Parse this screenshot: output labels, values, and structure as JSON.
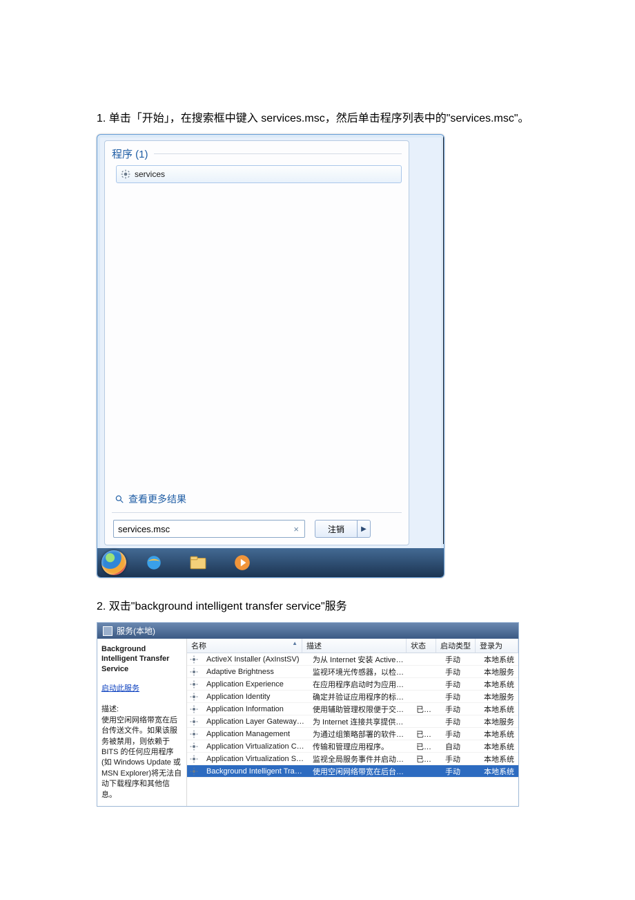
{
  "step1": "1. 单击「开始」，在搜索框中键入 services.msc，然后单击程序列表中的\"services.msc\"。",
  "step2": "2. 双击\"background intelligent transfer service\"服务",
  "startmenu": {
    "group_header": "程序 (1)",
    "result_label": "services",
    "more_results": "查看更多结果",
    "search_value": "services.msc",
    "logoff_label": "注销"
  },
  "services": {
    "window_title": "服务(本地)",
    "left": {
      "title": "Background Intelligent Transfer Service",
      "action": "启动此服务",
      "desc_header": "描述:",
      "desc": "使用空闲网络带宽在后台传送文件。如果该服务被禁用，则依赖于 BITS 的任何应用程序(如 Windows Update 或 MSN Explorer)将无法自动下载程序和其他信息。"
    },
    "columns": {
      "name": "名称",
      "desc": "描述",
      "status": "状态",
      "start": "启动类型",
      "logon": "登录为"
    },
    "rows": [
      {
        "name": "ActiveX Installer (AxInstSV)",
        "desc": "为从 Internet 安装 ActiveX 控件...",
        "status": "",
        "start": "手动",
        "logon": "本地系统"
      },
      {
        "name": "Adaptive Brightness",
        "desc": "监视环境光传感器，以检测环境光...",
        "status": "",
        "start": "手动",
        "logon": "本地服务"
      },
      {
        "name": "Application Experience",
        "desc": "在应用程序启动时为应用程序处理...",
        "status": "",
        "start": "手动",
        "logon": "本地系统"
      },
      {
        "name": "Application Identity",
        "desc": "确定并验证应用程序的标识。禁用...",
        "status": "",
        "start": "手动",
        "logon": "本地服务"
      },
      {
        "name": "Application Information",
        "desc": "使用辅助管理权限便于交互式应用...",
        "status": "已启动",
        "start": "手动",
        "logon": "本地系统"
      },
      {
        "name": "Application Layer Gateway Service",
        "desc": "为 Internet 连接共享提供第三方...",
        "status": "",
        "start": "手动",
        "logon": "本地服务"
      },
      {
        "name": "Application Management",
        "desc": "为通过组策略部署的软件处理安装...",
        "status": "已启动",
        "start": "手动",
        "logon": "本地系统"
      },
      {
        "name": "Application Virtualization Client",
        "desc": "传输和管理应用程序。",
        "status": "已启动",
        "start": "自动",
        "logon": "本地系统"
      },
      {
        "name": "Application Virtualization Service A...",
        "desc": "监视全局服务事件并启动虚拟服务...",
        "status": "已启动",
        "start": "手动",
        "logon": "本地系统"
      },
      {
        "name": "Background Intelligent Transfer Se...",
        "desc": "使用空闲网络带宽在后台传送文件...",
        "status": "",
        "start": "手动",
        "logon": "本地系统",
        "selected": true
      }
    ]
  }
}
